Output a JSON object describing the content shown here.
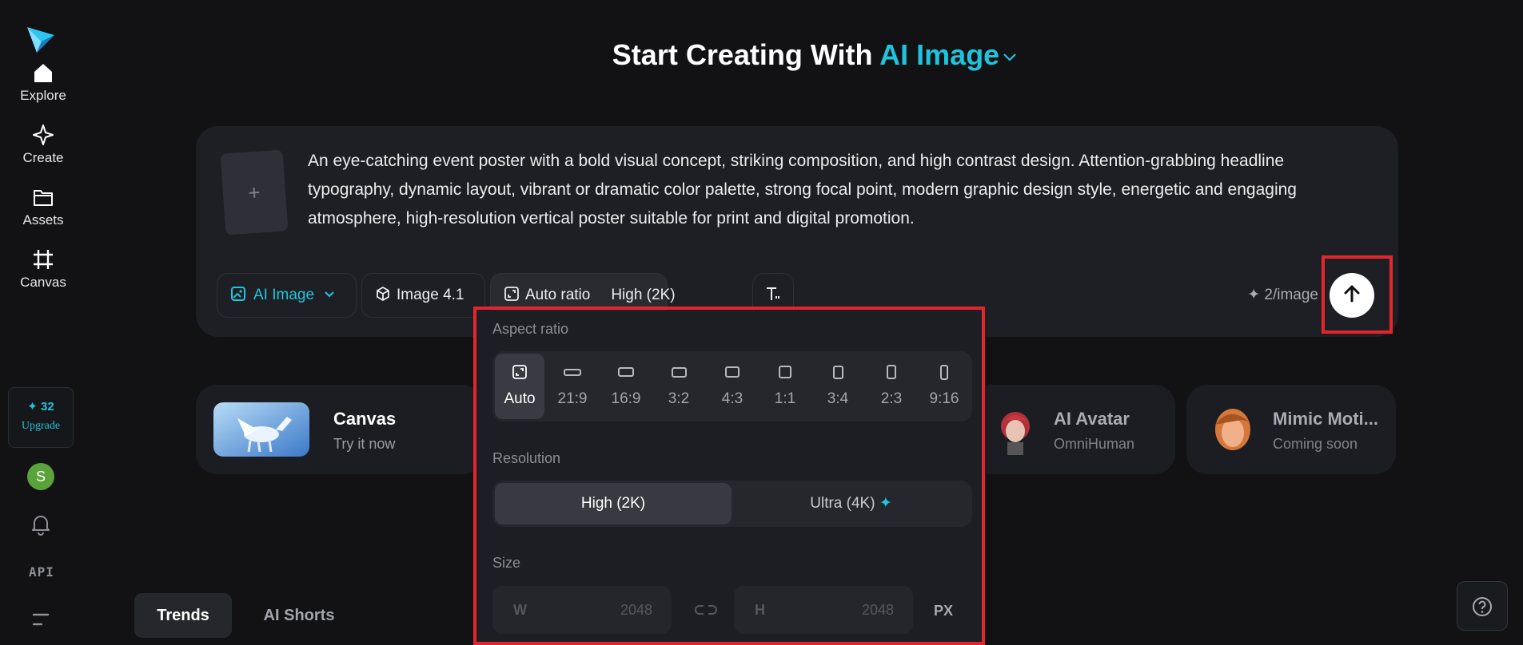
{
  "sidebar": {
    "logo": "paper-plane-logo",
    "items": [
      {
        "label": "Explore",
        "icon": "home-icon"
      },
      {
        "label": "Create",
        "icon": "sparkle-outline-icon"
      },
      {
        "label": "Assets",
        "icon": "folder-icon"
      },
      {
        "label": "Canvas",
        "icon": "crop-grid-icon"
      }
    ],
    "credits": "32",
    "credits_icon": "✦",
    "upgrade_label": "Upgrade",
    "avatar_initial": "S",
    "api_label": "API"
  },
  "header": {
    "title_prefix": "Start Creating With",
    "title_mode": "AI Image"
  },
  "prompt": {
    "upload_symbol": "+",
    "text": "An eye-catching event poster with a bold visual concept, striking composition, and high contrast design. Attention-grabbing headline typography, dynamic layout, vibrant or dramatic color palette, strong focal point, modern graphic design style, energetic and engaging atmosphere, high-resolution vertical poster suitable for print and digital promotion.",
    "toolbar": {
      "mode_label": "AI Image",
      "model_label": "Image 4.1",
      "ratio_label": "Auto ratio",
      "resolution_label": "High (2K)"
    },
    "cost": "✦ 2/image"
  },
  "features": [
    {
      "name": "Canvas",
      "sub": "Try it now"
    },
    {
      "name": "AI Avatar",
      "sub": "OmniHuman"
    },
    {
      "name": "Mimic Moti...",
      "sub": "Coming soon"
    }
  ],
  "popover": {
    "aspect_title": "Aspect ratio",
    "ratios": [
      "Auto",
      "21:9",
      "16:9",
      "3:2",
      "4:3",
      "1:1",
      "3:4",
      "2:3",
      "9:16"
    ],
    "selected_ratio": "Auto",
    "resolution_title": "Resolution",
    "resolution_options": [
      "High (2K)",
      "Ultra (4K)"
    ],
    "ultra_mark": "✦",
    "size_title": "Size",
    "width_key": "W",
    "width_value": "2048",
    "height_key": "H",
    "height_value": "2048",
    "unit": "PX"
  },
  "tabs": [
    {
      "label": "Trends"
    },
    {
      "label": "AI Shorts"
    }
  ],
  "colors": {
    "accent": "#1fc3dd",
    "background": "#121215",
    "highlight": "#e3262d"
  }
}
